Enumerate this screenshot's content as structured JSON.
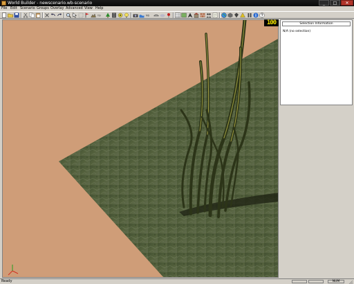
{
  "window": {
    "title": "World Builder - newscenario.wb-scenario",
    "minimize": "_",
    "maximize": "□",
    "close": "✕"
  },
  "menu": [
    "File",
    "Edit",
    "Scenario",
    "Groups",
    "Overlay",
    "Advanced",
    "View",
    "Help"
  ],
  "toolbar": {
    "icons": [
      "new-icon",
      "open-icon",
      "save-icon",
      "cut-icon",
      "copy-icon",
      "paste-icon",
      "undo-icon",
      "redo-icon",
      "pointer-icon",
      "zoom-icon",
      "flag-icon",
      "terrain-icon",
      "height-icon",
      "waypoint-icon",
      "tree-icon",
      "road-icon",
      "ns-icon",
      "camera-icon",
      "bridge-icon",
      "water-icon",
      "light-icon",
      "grid-icon",
      "map-icon",
      "nav-icon",
      "building-icon",
      "globe-icon",
      "wall-icon",
      "team-icon",
      "script-icon",
      "pin-icon",
      "fog-icon"
    ],
    "text_labels": {
      "terrain_label": "TEX",
      "ns_label": "NS"
    }
  },
  "viewport": {
    "fps": "100",
    "ground_color": "#cf9d78",
    "terrain_color": "#4c5a3a"
  },
  "selection_panel": {
    "header": "Selection Information",
    "info": "N/A (no selection)"
  },
  "status": {
    "text": "Ready",
    "num": "NUM"
  }
}
